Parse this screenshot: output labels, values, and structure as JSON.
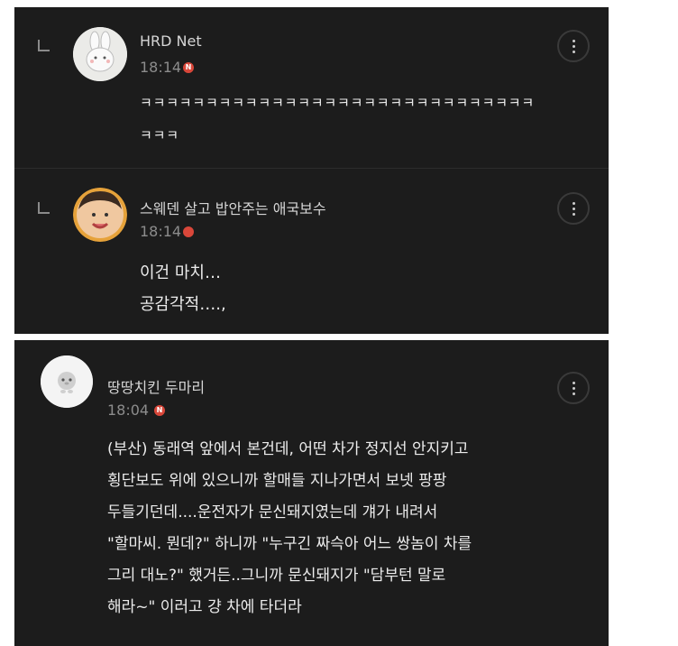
{
  "comments": [
    {
      "author": "HRD Net",
      "time": "18:14",
      "badge": "N",
      "lines": [
        "ㅋㅋㅋㅋㅋㅋㅋㅋㅋㅋㅋㅋㅋㅋㅋㅋㅋㅋㅋㅋㅋㅋㅋㅋㅋㅋㅋㅋㅋㅋ",
        "ㅋㅋㅋ"
      ]
    },
    {
      "author": "스웨덴 살고 밥안주는 애국보수",
      "time": "18:14",
      "badge": "",
      "lines": [
        "이건 마치…",
        "공감각적….,"
      ]
    },
    {
      "author": "땅땅치킨 두마리",
      "time": "18:04",
      "badge": "N",
      "lines": [
        "(부산) 동래역 앞에서 본건데, 어떤 차가 정지선 안지키고",
        "횡단보도 위에 있으니까 할매들 지나가면서 보넷 팡팡",
        "두들기던데....운전자가 문신돼지였는데 걔가 내려서",
        "\"할마씨. 뭔데?\" 하니까 \"누구긴 짜슥아 어느 쌍놈이 차를",
        "그리 대노?\" 했거든..그니까 문신돼지가 \"담부턴 말로",
        "해라~\" 이러고 걍 차에 타더라"
      ]
    }
  ],
  "icons": {
    "reply": "reply-arrow-icon",
    "more": "more-vertical-icon"
  },
  "colors": {
    "panel": "#1c1c1c",
    "badge": "#d9473a",
    "text": "#ececec",
    "meta": "#8c8c8c"
  }
}
